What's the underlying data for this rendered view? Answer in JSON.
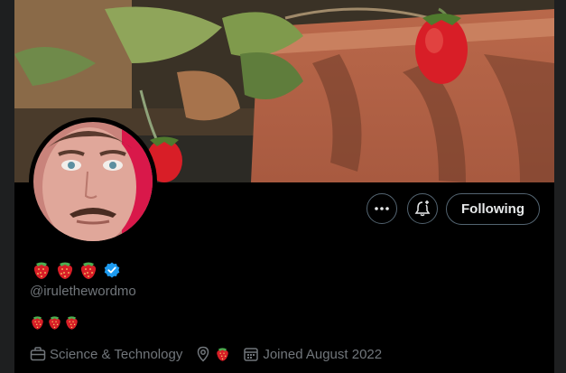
{
  "profile": {
    "display_name_emojis": [
      "strawberry",
      "strawberry",
      "strawberry"
    ],
    "verified": true,
    "handle": "@irulethewordmo",
    "bio_emojis": [
      "strawberry",
      "strawberry",
      "strawberry"
    ],
    "category": "Science & Technology",
    "location_emoji": "strawberry",
    "joined": "Joined August 2022"
  },
  "actions": {
    "more_icon": "more-dots-icon",
    "notify_icon": "bell-plus-icon",
    "follow_label": "Following"
  },
  "colors": {
    "background": "#000000",
    "border": "#536471",
    "secondary_text": "#71767b",
    "verified_blue": "#1d9bf0",
    "strawberry_red": "#d81e27"
  }
}
